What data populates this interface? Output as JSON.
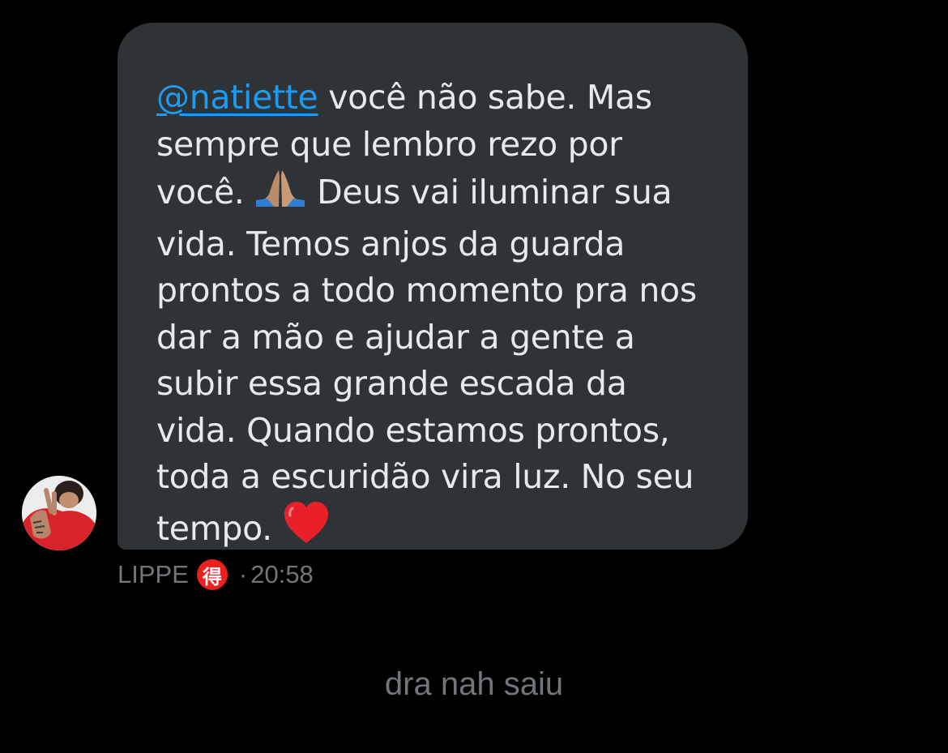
{
  "message": {
    "mention": "@natiette",
    "line1_rest": " você não sabe. Mas sempre que lembro rezo por você. ",
    "after_pray": " Deus vai iluminar sua vida. Temos anjos da guarda prontos a todo momento pra nos dar a mão e ajudar a gente a subir essa grande escada da vida. Quando estamos prontos, toda a escuridão vira luz. No seu tempo. ",
    "emojis": [
      "praying-hands",
      "red-heart"
    ]
  },
  "sender": {
    "name": "LIPPE",
    "badge": "得",
    "separator": "·",
    "time": "20:58"
  },
  "footer": {
    "status_text": "dra nah saiu"
  },
  "colors": {
    "background": "#000000",
    "bubble": "#2f3336",
    "text": "#e7e9ea",
    "mention": "#1d9bf0",
    "muted": "#71767b",
    "badge": "#e8211f"
  }
}
